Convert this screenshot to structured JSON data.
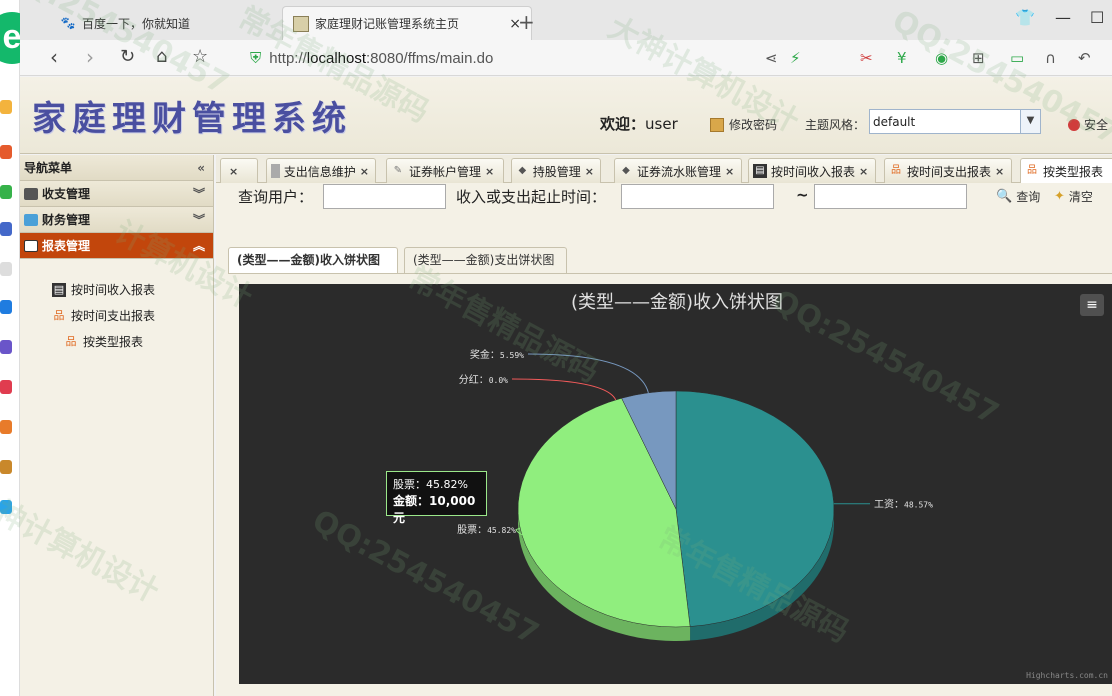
{
  "browser": {
    "tabs": [
      {
        "title": "百度一下，你就知道",
        "icon": "baidu-paw-icon",
        "active": false
      },
      {
        "title": "家庭理财记账管理系统主页",
        "icon": "page-favicon-icon",
        "active": true
      }
    ],
    "close_glyph": "×",
    "new_tab_glyph": "+",
    "url_prefix": "http://",
    "url_host": "localhost",
    "url_rest": ":8080/ffms/main.do"
  },
  "header": {
    "app_title": "家庭理财管理系统",
    "welcome_label": "欢迎：",
    "username": "user",
    "change_password": "修改密码",
    "theme_label": "主题风格：",
    "theme_value": "default",
    "safety_label": "安全"
  },
  "nav": {
    "title": "导航菜单",
    "groups": [
      {
        "label": "收支管理",
        "expanded": false
      },
      {
        "label": "财务管理",
        "expanded": false
      },
      {
        "label": "报表管理",
        "expanded": true
      }
    ],
    "report_items": [
      "按时间收入报表",
      "按时间支出报表",
      "按类型报表"
    ]
  },
  "content_tabs": [
    {
      "label": ""
    },
    {
      "label": "支出信息维护"
    },
    {
      "label": "证券帐户管理"
    },
    {
      "label": "持股管理"
    },
    {
      "label": "证券流水账管理"
    },
    {
      "label": "按时间收入报表"
    },
    {
      "label": "按时间支出报表"
    },
    {
      "label": "按类型报表"
    }
  ],
  "query": {
    "user_label": "查询用户：",
    "time_label": "收入或支出起止时间：",
    "range_sep": "~",
    "search_button": "查询",
    "clear_button": "清空"
  },
  "chart_tabs": [
    {
      "label": "(类型——金额)收入饼状图",
      "active": true
    },
    {
      "label": "(类型——金额)支出饼状图",
      "active": false
    }
  ],
  "tooltip": {
    "line1": "股票：45.82%",
    "line2": "金额：10,000元"
  },
  "chart_credit": "Highcharts.com.cn",
  "colors": {
    "chart_bg": "#2b2b2b",
    "salary": "#2b908f",
    "stocks": "#90ee7e",
    "bonus": "#7798bf",
    "dividend": "#f45b5b",
    "nav_active": "#c2460c",
    "title_blue": "#4a4fa0"
  },
  "chart_data": {
    "type": "pie",
    "title": "(类型——金额)收入饼状图",
    "series": [
      {
        "slices": [
          {
            "name": "工资",
            "percent": 48.57,
            "label": "工资：48.57%"
          },
          {
            "name": "股票",
            "percent": 45.82,
            "label": "股票：45.82%",
            "amount": 10000
          },
          {
            "name": "分红",
            "percent": 0.0,
            "label": "分红：0.0%"
          },
          {
            "name": "奖金",
            "percent": 5.59,
            "label": "奖金：5.59%"
          }
        ]
      }
    ],
    "legend": false,
    "3d": true
  },
  "watermarks": [
    "QQ:254540457",
    "常年售精品源码",
    "大神计算机设计",
    "QQ:254540457",
    "计算机设计",
    "常年售精品源码",
    "QQ:254540457",
    "大神计算机设计"
  ]
}
